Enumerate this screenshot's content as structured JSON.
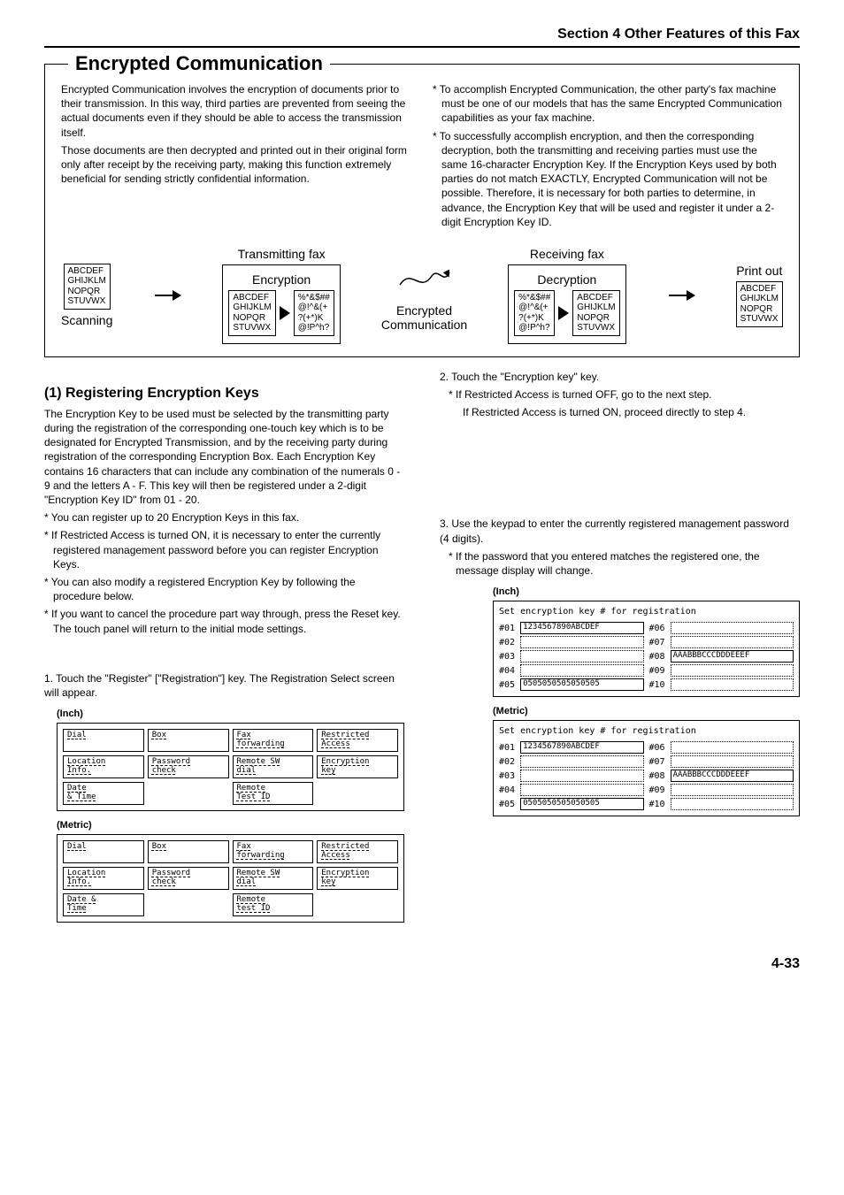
{
  "section_header": "Section 4 Other Features of this Fax",
  "main_title": "Encrypted Communication",
  "intro_left_1": "Encrypted Communication involves the encryption of documents prior to their transmission. In this way, third parties are prevented from seeing the actual documents even if they should be able to access the transmission itself.",
  "intro_left_2": "Those documents are then decrypted and printed out in their original form only after receipt by the receiving party, making this function extremely beneficial for sending strictly confidential information.",
  "intro_right_1": "* To accomplish Encrypted Communication, the other party's fax machine must be one of our models that has the same Encrypted Communication capabilities as your fax machine.",
  "intro_right_2": "* To successfully accomplish encryption, and then the corresponding decryption, both the transmitting and receiving parties must use the same 16-character Encryption Key. If the Encryption Keys used by both parties do not match EXACTLY, Encrypted Communication will not be possible. Therefore, it is necessary for both parties to determine, in advance, the Encryption Key that will be used and register it under a 2-digit Encryption Key ID.",
  "diagram": {
    "plain_lines": "ABCDEF\nGHIJKLM\nNOPQR\nSTUVWX",
    "cipher_lines": "%*&$##\n@!^&(+\n?(+*)K\n@!P^h?",
    "transmitting": "Transmitting fax",
    "receiving": "Receiving fax",
    "encryption": "Encryption",
    "decryption": "Decryption",
    "scanning": "Scanning",
    "encrypted_comm": "Encrypted\nCommunication",
    "printout": "Print out"
  },
  "subheading1": "(1) Registering Encryption Keys",
  "reg_para": "The Encryption Key to be used must be selected by the transmitting party during the registration of the corresponding one-touch key which is to be designated for Encrypted Transmission, and by the receiving party during registration of the corresponding Encryption Box. Each Encryption Key contains 16 characters that can include any combination of the numerals 0 - 9 and the letters A - F. This key will then be registered under a 2-digit \"Encryption Key ID\" from 01 - 20.",
  "reg_note1": "* You can register up to 20 Encryption Keys in this fax.",
  "reg_note2": "* If Restricted Access is turned ON, it is necessary to enter the currently registered management password before you can register Encryption Keys.",
  "reg_note3": "* You can also modify a registered Encryption Key by following the procedure below.",
  "reg_note4": "* If you want to cancel the procedure part way through, press the Reset key. The touch panel will return to the initial mode settings.",
  "step1": "1. Touch the \"Register\" [\"Registration\"] key. The Registration Select screen will appear.",
  "step2": "2. Touch the \"Encryption key\" key.",
  "step2_note1": "* If Restricted Access is turned OFF, go to the next step.",
  "step2_note2": "If Restricted Access is turned ON, proceed directly to step 4.",
  "step3": "3. Use the keypad to enter the currently registered management password (4 digits).",
  "step3_note": "* If the password that you entered matches the registered one, the message display will change.",
  "label_inch": "(Inch)",
  "label_metric": "(Metric)",
  "regscreen_inch": {
    "r1": [
      "Dial",
      "Box",
      "Fax\nforwarding",
      "Restricted\nAccess"
    ],
    "r2": [
      "Location\nInfo.",
      "Password\ncheck",
      "Remote SW\ndial",
      "Encryption\nkey"
    ],
    "r3": [
      "Date\n& Time",
      "",
      "Remote\nTest ID",
      ""
    ]
  },
  "regscreen_metric": {
    "r1": [
      "Dial",
      "Box",
      "Fax\nforwarding",
      "Restricted\nAccess"
    ],
    "r2": [
      "Location\nInfo.",
      "Password\ncheck",
      "Remote SW\ndial",
      "Encryption\nkey"
    ],
    "r3": [
      "Date &\nTime",
      "",
      "Remote\ntest ID",
      ""
    ]
  },
  "enc_title": "Set encryption key # for registration",
  "enc_rows": {
    "left_ids": [
      "#01",
      "#02",
      "#03",
      "#04",
      "#05"
    ],
    "right_ids": [
      "#06",
      "#07",
      "#08",
      "#09",
      "#10"
    ],
    "val01": "1234567890ABCDEF",
    "val05": "0505050505050505",
    "val08": "AAABBBCCCDDDEEEF"
  },
  "page_num": "4-33"
}
